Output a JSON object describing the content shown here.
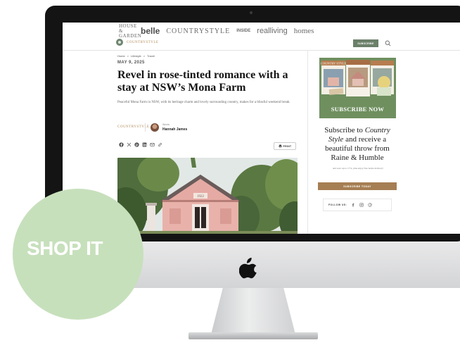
{
  "header": {
    "brands": [
      "HOUSE & GARDEN",
      "belle",
      "COUNTRYSTYLE",
      "INSIDE",
      "realliving",
      "homes"
    ],
    "site_logo": "COUNTRYSTYLE",
    "subscribe_label": "SUBSCRIBE"
  },
  "article": {
    "breadcrumb": [
      "Home",
      "Lifestyle",
      "Travel"
    ],
    "breadcrumb_sep": ">",
    "date": "MAY 9, 2025",
    "headline": "Revel in rose-tinted romance with a stay at NSW’s Mona Farm",
    "standfirst": "Peaceful Mona Farm in NSW, with its heritage charm and lovely surrounding country, makes for a blissful weekend break.",
    "byline_brand": "COUNTRYSTYLE",
    "words_label": "Words",
    "author": "Hannah James",
    "print_label": "PRINT",
    "house_sign": "1922"
  },
  "sidebar": {
    "mag_title": "COUNTRY STYLE",
    "mag_banner": "SUBSCRIBE NOW",
    "promo_parts": [
      "Subscribe to ",
      "Country Style",
      " and receive a beautiful throw from Raine & Humble"
    ],
    "promo_small": "and save up to 17%, plus enjoy free home delivery!",
    "cta_label": "SUBSCRIBE TODAY",
    "follow_label": "FOLLOW US:"
  },
  "badge": {
    "label": "SHOP IT"
  },
  "colors": {
    "badge": "#c7e0bc",
    "accent_green": "#6b8069",
    "accent_brown": "#a67e53",
    "bezel": "#141414"
  },
  "icons": {
    "share": [
      "facebook-icon",
      "x-icon",
      "pinterest-icon",
      "linkedin-icon",
      "email-icon",
      "link-icon"
    ],
    "follow": [
      "facebook-icon",
      "instagram-icon",
      "pinterest-icon"
    ]
  }
}
